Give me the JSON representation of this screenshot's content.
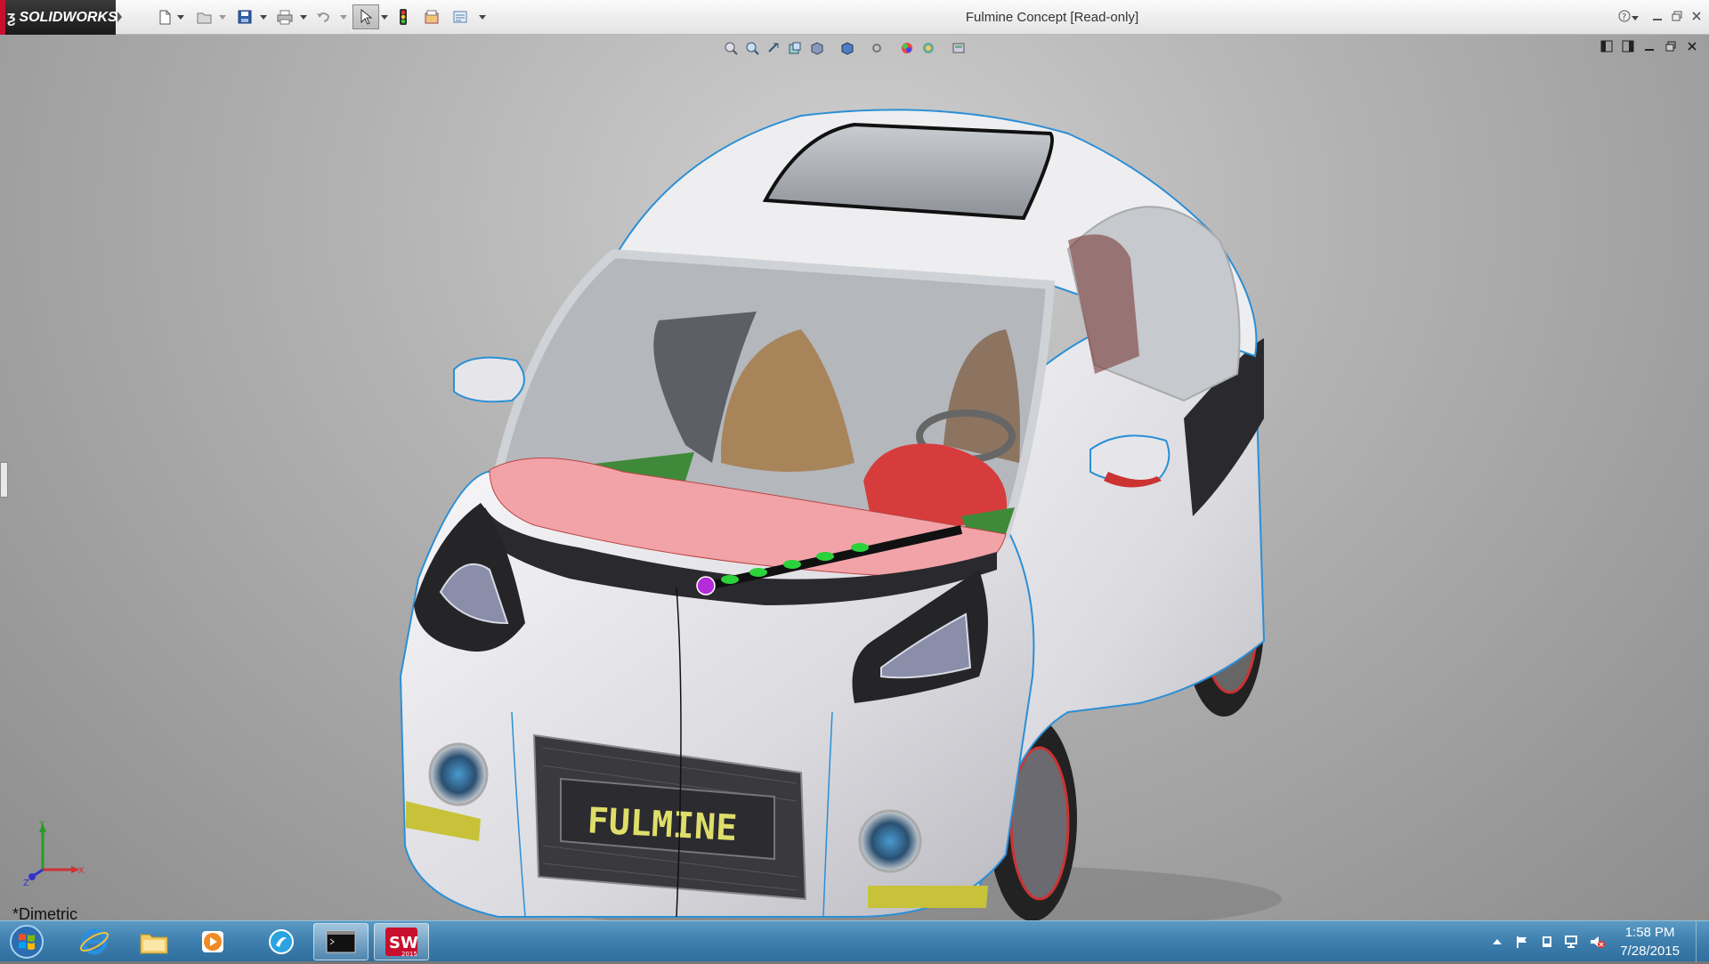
{
  "app": {
    "brand": "SOLIDWORKS",
    "window_title": "Fulmine Concept [Read-only]"
  },
  "toolbar": {
    "items": [
      "new-file",
      "open-file",
      "save",
      "print",
      "undo",
      "select",
      "rebuild",
      "file-properties",
      "options"
    ]
  },
  "heads_up_toolbar": {
    "items": [
      "zoom-to-fit",
      "zoom-to-area",
      "previous-view",
      "section-view",
      "view-orientation",
      "display-style",
      "hide-show-items",
      "edit-appearance",
      "apply-scene",
      "view-settings"
    ]
  },
  "viewport": {
    "view_label": "*Dimetric",
    "car_badge": "FULMINE",
    "triad": {
      "x": "X",
      "y": "Y",
      "z": "Z"
    }
  },
  "taskbar": {
    "apps": [
      "start",
      "internet-explorer",
      "file-explorer",
      "media-player",
      "solidworks-composer",
      "command-prompt",
      "solidworks-2015"
    ],
    "sw_badge": "2015",
    "clock_time": "1:58 PM",
    "clock_date": "7/28/2015"
  },
  "colors": {
    "accent_red": "#c8102e",
    "taskbar_blue": "#3f7fae",
    "car_body": "#e9e9ec",
    "edge_blue": "#2b8fd6",
    "badge_yellow": "#dede6a",
    "seat_red": "#d63c3c",
    "dash_pink": "#f2a3a8",
    "selection_green": "#2bd23a",
    "selection_magenta": "#b52bd9"
  }
}
